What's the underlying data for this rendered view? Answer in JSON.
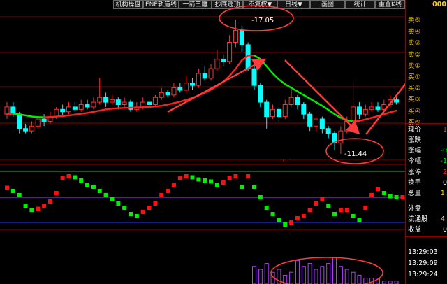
{
  "toolbar": {
    "buttons": [
      {
        "label": "机构操盘",
        "name": "toolbar-button-institutional"
      },
      {
        "label": "ENE轨道线",
        "name": "toolbar-button-ene"
      },
      {
        "label": "一箭三雕",
        "name": "toolbar-button-yijian"
      },
      {
        "label": "抄底逃顶",
        "name": "toolbar-button-chaodi"
      },
      {
        "label": "不复权▼",
        "name": "toolbar-button-adjust"
      },
      {
        "label": "日线▼",
        "name": "toolbar-button-period"
      },
      {
        "label": "画图",
        "name": "toolbar-button-draw"
      },
      {
        "label": "统计",
        "name": "toolbar-button-stats"
      },
      {
        "label": "重置K线",
        "name": "toolbar-button-reset"
      }
    ]
  },
  "annotations": {
    "high_label": "-17.05",
    "low_label": "-11.44",
    "marker": "q"
  },
  "colors": {
    "up": "#ff3030",
    "down": "#00ffff",
    "ma_up": "#ff2020",
    "ma_down": "#00ee00",
    "osc_up": "#ff1010",
    "osc_down": "#00ee00",
    "arrow": "#ff3b3b",
    "circle": "#ff3b3b",
    "purple": "#b040ff",
    "grid": "#8b0000",
    "yellow": "#ffd400"
  },
  "candles": [
    {
      "o": 13.1,
      "c": 13.4,
      "h": 13.6,
      "l": 12.9
    },
    {
      "o": 13.4,
      "c": 13.1,
      "h": 13.6,
      "l": 13.0
    },
    {
      "o": 13.1,
      "c": 12.5,
      "h": 13.2,
      "l": 12.3
    },
    {
      "o": 12.5,
      "c": 12.4,
      "h": 12.7,
      "l": 12.3
    },
    {
      "o": 12.4,
      "c": 12.6,
      "h": 12.8,
      "l": 12.3
    },
    {
      "o": 12.6,
      "c": 12.9,
      "h": 13.0,
      "l": 12.5
    },
    {
      "o": 12.9,
      "c": 12.8,
      "h": 13.1,
      "l": 12.6
    },
    {
      "o": 12.8,
      "c": 13.0,
      "h": 13.2,
      "l": 12.7
    },
    {
      "o": 13.0,
      "c": 13.3,
      "h": 13.4,
      "l": 12.9
    },
    {
      "o": 13.3,
      "c": 13.2,
      "h": 13.5,
      "l": 13.0
    },
    {
      "o": 13.2,
      "c": 13.4,
      "h": 13.6,
      "l": 13.1
    },
    {
      "o": 13.4,
      "c": 13.3,
      "h": 13.6,
      "l": 13.2
    },
    {
      "o": 13.3,
      "c": 13.5,
      "h": 13.7,
      "l": 13.2
    },
    {
      "o": 13.5,
      "c": 13.4,
      "h": 13.7,
      "l": 13.3
    },
    {
      "o": 13.4,
      "c": 13.6,
      "h": 13.8,
      "l": 13.3
    },
    {
      "o": 13.6,
      "c": 13.8,
      "h": 14.6,
      "l": 13.5
    },
    {
      "o": 13.8,
      "c": 13.6,
      "h": 14.0,
      "l": 13.4
    },
    {
      "o": 13.6,
      "c": 13.7,
      "h": 13.9,
      "l": 13.5
    },
    {
      "o": 13.7,
      "c": 13.5,
      "h": 13.8,
      "l": 13.3
    },
    {
      "o": 13.5,
      "c": 13.6,
      "h": 13.8,
      "l": 13.4
    },
    {
      "o": 13.6,
      "c": 13.3,
      "h": 13.7,
      "l": 13.2
    },
    {
      "o": 13.3,
      "c": 13.4,
      "h": 13.6,
      "l": 13.2
    },
    {
      "o": 13.4,
      "c": 13.6,
      "h": 13.8,
      "l": 13.3
    },
    {
      "o": 13.6,
      "c": 13.5,
      "h": 13.7,
      "l": 13.4
    },
    {
      "o": 13.5,
      "c": 13.8,
      "h": 13.9,
      "l": 13.4
    },
    {
      "o": 13.8,
      "c": 14.0,
      "h": 14.2,
      "l": 13.7
    },
    {
      "o": 14.0,
      "c": 13.9,
      "h": 14.1,
      "l": 13.8
    },
    {
      "o": 13.9,
      "c": 14.2,
      "h": 14.4,
      "l": 13.8
    },
    {
      "o": 14.2,
      "c": 14.1,
      "h": 14.4,
      "l": 14.0
    },
    {
      "o": 14.1,
      "c": 14.4,
      "h": 14.7,
      "l": 14.0
    },
    {
      "o": 14.4,
      "c": 14.3,
      "h": 14.6,
      "l": 14.1
    },
    {
      "o": 14.3,
      "c": 14.8,
      "h": 15.0,
      "l": 14.2
    },
    {
      "o": 14.8,
      "c": 14.6,
      "h": 15.1,
      "l": 14.5
    },
    {
      "o": 14.6,
      "c": 15.0,
      "h": 15.2,
      "l": 14.5
    },
    {
      "o": 15.0,
      "c": 15.4,
      "h": 15.8,
      "l": 14.9
    },
    {
      "o": 15.4,
      "c": 15.3,
      "h": 15.6,
      "l": 15.1
    },
    {
      "o": 15.3,
      "c": 16.1,
      "h": 16.4,
      "l": 15.2
    },
    {
      "o": 16.1,
      "c": 16.6,
      "h": 17.05,
      "l": 15.9
    },
    {
      "o": 16.6,
      "c": 16.0,
      "h": 16.8,
      "l": 15.7
    },
    {
      "o": 16.0,
      "c": 15.0,
      "h": 16.1,
      "l": 14.9
    },
    {
      "o": 15.0,
      "c": 14.3,
      "h": 15.1,
      "l": 14.1
    },
    {
      "o": 14.3,
      "c": 13.6,
      "h": 14.4,
      "l": 13.4
    },
    {
      "o": 13.6,
      "c": 13.0,
      "h": 13.7,
      "l": 12.5
    },
    {
      "o": 13.0,
      "c": 13.3,
      "h": 13.5,
      "l": 12.9
    },
    {
      "o": 13.3,
      "c": 13.0,
      "h": 13.4,
      "l": 12.8
    },
    {
      "o": 13.0,
      "c": 13.5,
      "h": 13.7,
      "l": 12.9
    },
    {
      "o": 13.5,
      "c": 13.8,
      "h": 14.1,
      "l": 13.4
    },
    {
      "o": 13.8,
      "c": 13.5,
      "h": 13.9,
      "l": 13.3
    },
    {
      "o": 13.5,
      "c": 13.1,
      "h": 13.6,
      "l": 12.9
    },
    {
      "o": 13.1,
      "c": 12.6,
      "h": 13.2,
      "l": 12.4
    },
    {
      "o": 12.6,
      "c": 12.9,
      "h": 13.0,
      "l": 12.4
    },
    {
      "o": 12.9,
      "c": 12.5,
      "h": 13.0,
      "l": 12.3
    },
    {
      "o": 12.5,
      "c": 12.3,
      "h": 12.6,
      "l": 12.1
    },
    {
      "o": 12.3,
      "c": 11.9,
      "h": 12.4,
      "l": 11.6
    },
    {
      "o": 11.9,
      "c": 12.4,
      "h": 12.6,
      "l": 11.44
    },
    {
      "o": 12.4,
      "c": 12.8,
      "h": 13.0,
      "l": 12.3
    },
    {
      "o": 12.8,
      "c": 13.4,
      "h": 14.4,
      "l": 12.7
    },
    {
      "o": 13.4,
      "c": 13.1,
      "h": 13.6,
      "l": 12.9
    },
    {
      "o": 13.1,
      "c": 13.3,
      "h": 13.5,
      "l": 13.0
    },
    {
      "o": 13.3,
      "c": 13.4,
      "h": 13.6,
      "l": 13.2
    },
    {
      "o": 13.4,
      "c": 13.3,
      "h": 13.6,
      "l": 13.2
    },
    {
      "o": 13.3,
      "c": 13.5,
      "h": 13.7,
      "l": 13.2
    },
    {
      "o": 13.5,
      "c": 13.7,
      "h": 13.9,
      "l": 13.4
    },
    {
      "o": 13.7,
      "c": 13.6,
      "h": 13.8,
      "l": 13.5
    }
  ],
  "ma": [
    13.1,
    13.12,
    13.1,
    13.05,
    13.0,
    12.98,
    12.97,
    12.98,
    13.0,
    13.02,
    13.05,
    13.08,
    13.12,
    13.15,
    13.2,
    13.25,
    13.3,
    13.33,
    13.35,
    13.36,
    13.37,
    13.38,
    13.39,
    13.4,
    13.42,
    13.45,
    13.5,
    13.56,
    13.62,
    13.7,
    13.78,
    13.88,
    14.0,
    14.12,
    14.28,
    14.45,
    14.7,
    15.0,
    15.35,
    15.55,
    15.55,
    15.4,
    15.1,
    14.8,
    14.55,
    14.35,
    14.2,
    14.05,
    13.9,
    13.75,
    13.6,
    13.45,
    13.28,
    13.1,
    12.95,
    12.85,
    12.8,
    12.82,
    12.88,
    12.95,
    13.02,
    13.1,
    13.18,
    13.25,
    13.3
  ],
  "osc": [
    0.45,
    0.3,
    0.1,
    -0.4,
    -0.6,
    -0.55,
    -0.4,
    -0.2,
    0.2,
    0.9,
    1.0,
    0.95,
    0.8,
    0.6,
    0.5,
    0.3,
    0.1,
    -0.1,
    -0.3,
    -0.5,
    -0.8,
    -0.9,
    -0.7,
    -0.5,
    -0.3,
    0.1,
    0.3,
    0.6,
    0.9,
    1.0,
    0.95,
    0.85,
    0.8,
    0.75,
    0.6,
    0.7,
    0.9,
    1.0,
    0.5,
    1.0,
    0.5,
    0.0,
    -0.5,
    -0.8,
    -1.1,
    -1.3,
    -1.2,
    -1.0,
    -0.9,
    -0.6,
    -0.3,
    -0.1,
    -0.4,
    -0.8,
    -0.6,
    -0.6,
    -0.9,
    -1.1,
    -0.5,
    0.1,
    0.4,
    0.2,
    0.05,
    0.0,
    0.0
  ],
  "volume": [
    1,
    1,
    1,
    0.5,
    0.5,
    0.5,
    0.5,
    0.5,
    1,
    1,
    1,
    1,
    1,
    1,
    1,
    2,
    1,
    1,
    1,
    1,
    1,
    1,
    1,
    1,
    1,
    1,
    1,
    1,
    1,
    1,
    1,
    2,
    1,
    1,
    2,
    2,
    3,
    4,
    3,
    5,
    6,
    5,
    7,
    4,
    5,
    3,
    4,
    8,
    6,
    7,
    5,
    6,
    7,
    9,
    6,
    5,
    4,
    3,
    2,
    2,
    2,
    1,
    1,
    1
  ],
  "panel": {
    "code": "000",
    "orders": [
      "卖⑤",
      "卖④",
      "卖③",
      "卖②",
      "卖①",
      "买①",
      "买②",
      "买③",
      "买④",
      "买⑤"
    ],
    "stats": [
      {
        "label": "现价",
        "value": "1",
        "color": "#ff3030"
      },
      {
        "label": "涨跌",
        "value": "",
        "color": "#ffffff"
      },
      {
        "label": "涨幅",
        "value": "-0",
        "color": "#00ee00"
      },
      {
        "label": "今幅",
        "value": "-1",
        "color": "#00ee00"
      },
      {
        "label": "涨停",
        "value": "2",
        "color": "#ff3030"
      },
      {
        "label": "换手",
        "value": "0",
        "color": "#ffffff"
      },
      {
        "label": "总量",
        "value": "1.",
        "color": "#ffd400"
      },
      {
        "label": "外盘",
        "value": "",
        "color": "#ffffff"
      },
      {
        "label": "流通股",
        "value": "4.",
        "color": "#ffd400"
      },
      {
        "label": "收益",
        "value": "0",
        "color": "#ffffff"
      }
    ],
    "times": [
      "13:29:03",
      "13:29:09",
      "13:29:24"
    ]
  }
}
